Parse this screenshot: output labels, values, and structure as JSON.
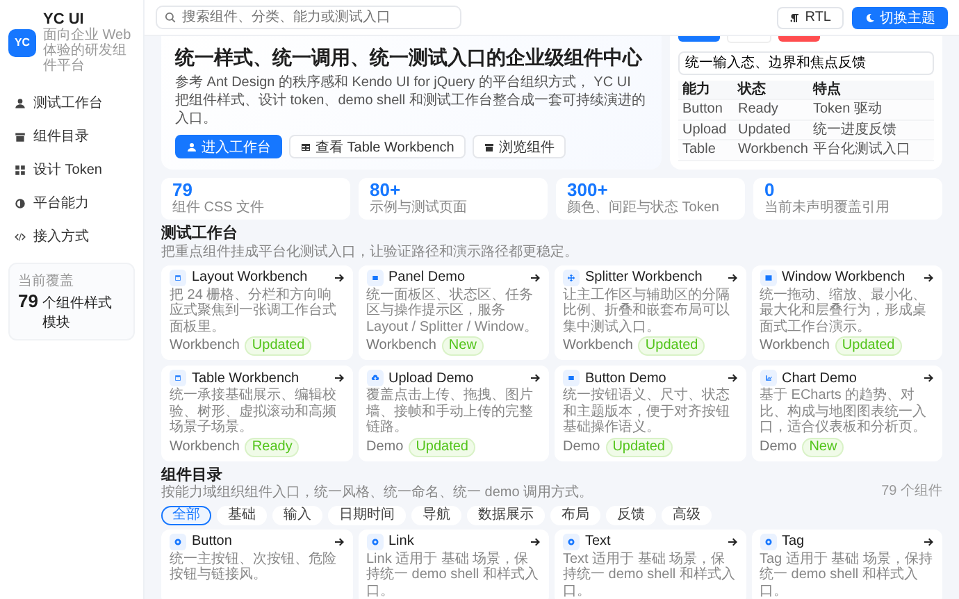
{
  "sidebar": {
    "logo": "YC",
    "title": "YC UI",
    "subtitle": "面向企业 Web 体验的研发组件平台",
    "items": [
      {
        "label": "测试工作台"
      },
      {
        "label": "组件目录"
      },
      {
        "label": "设计 Token"
      },
      {
        "label": "平台能力"
      },
      {
        "label": "接入方式"
      }
    ],
    "coverage": {
      "label": "当前覆盖",
      "count": "79",
      "text": "个组件样式模块"
    }
  },
  "header": {
    "search_placeholder": "搜索组件、分类、能力或测试入口",
    "buttons": [
      {
        "label": "RTL",
        "kind": "default"
      },
      {
        "label": "切换主题",
        "kind": "primary"
      }
    ]
  },
  "hero": {
    "title": "统一样式、统一调用、统一测试入口的企业级组件中心",
    "description": "参考 Ant Design 的秩序感和 Kendo UI for jQuery 的平台组织方式， YC UI 把组件样式、设计 token、demo shell 和测试工作台整合成一套可持续演进的入口。",
    "buttons": [
      {
        "label": "进入工作台",
        "kind": "primary"
      },
      {
        "label": "查看 Table Workbench",
        "kind": "default"
      },
      {
        "label": "浏览组件",
        "kind": "default"
      }
    ]
  },
  "demo_panel": {
    "top_buttons": [
      {
        "kind": "primary"
      },
      {
        "kind": "default"
      },
      {
        "kind": "danger"
      }
    ],
    "input_value": "统一输入态、边界和焦点反馈",
    "columns": [
      "能力",
      "状态",
      "特点"
    ],
    "rows": [
      [
        "Button",
        "Ready",
        "Token 驱动"
      ],
      [
        "Upload",
        "Updated",
        "统一进度反馈"
      ],
      [
        "Table",
        "Workbench",
        "平台化测试入口"
      ]
    ]
  },
  "stats": [
    {
      "value": "79",
      "label": "组件 CSS 文件"
    },
    {
      "value": "80+",
      "label": "示例与测试页面"
    },
    {
      "value": "300+",
      "label": "颜色、间距与状态 Token"
    },
    {
      "value": "0",
      "label": "当前未声明覆盖引用"
    }
  ],
  "workbench": {
    "title": "测试工作台",
    "description": "把重点组件挂成平台化测试入口，让验证路径和演示路径都更稳定。",
    "cards": [
      {
        "title": "Layout Workbench",
        "description": "把 24 栅格、分栏和方向响应式聚焦到一张调工作台式面板里。",
        "type": "Workbench",
        "status": "Updated"
      },
      {
        "title": "Panel Demo",
        "description": "统一面板区、状态区、任务区与操作提示区，服务 Layout / Splitter / Window。",
        "type": "Workbench",
        "status": "New"
      },
      {
        "title": "Splitter Workbench",
        "description": "让主工作区与辅助区的分隔比例、折叠和嵌套布局可以集中测试入口。",
        "type": "Workbench",
        "status": "Updated"
      },
      {
        "title": "Window Workbench",
        "description": "统一拖动、缩放、最小化、最大化和层叠行为，形成桌面式工作台演示。",
        "type": "Workbench",
        "status": "Updated"
      },
      {
        "title": "Table Workbench",
        "description": "统一承接基础展示、编辑校验、树形、虚拟滚动和高频场景子场景。",
        "type": "Workbench",
        "status": "Ready"
      },
      {
        "title": "Upload Demo",
        "description": "覆盖点击上传、拖拽、图片墙、接帧和手动上传的完整链路。",
        "type": "Demo",
        "status": "Updated"
      },
      {
        "title": "Button Demo",
        "description": "统一按钮语义、尺寸、状态和主题版本，便于对齐按钮基础操作语义。",
        "type": "Demo",
        "status": "Updated"
      },
      {
        "title": "Chart Demo",
        "description": "基于 ECharts 的趋势、对比、构成与地图图表统一入口，适合仪表板和分析页。",
        "type": "Demo",
        "status": "New"
      }
    ]
  },
  "catalog": {
    "title": "组件目录",
    "description": "按能力域组织组件入口，统一风格、统一命名、统一 demo 调用方式。",
    "count": "79 个组件",
    "filters": [
      {
        "label": "全部",
        "selected": true
      },
      {
        "label": "基础",
        "selected": false
      },
      {
        "label": "输入",
        "selected": false
      },
      {
        "label": "日期时间",
        "selected": false
      },
      {
        "label": "导航",
        "selected": false
      },
      {
        "label": "数据展示",
        "selected": false
      },
      {
        "label": "布局",
        "selected": false
      },
      {
        "label": "反馈",
        "selected": false
      },
      {
        "label": "高级",
        "selected": false
      }
    ],
    "cards": [
      {
        "title": "Button",
        "description": "统一主按钮、次按钮、危险按钮与链接风。"
      },
      {
        "title": "Link",
        "description": "Link 适用于 基础 场景，保持统一 demo shell 和样式入口。"
      },
      {
        "title": "Text",
        "description": "Text 适用于 基础 场景，保持统一 demo shell 和样式入口。"
      },
      {
        "title": "Tag",
        "description": "Tag 适用于 基础 场景，保持统一 demo shell 和样式入口。"
      }
    ]
  }
}
